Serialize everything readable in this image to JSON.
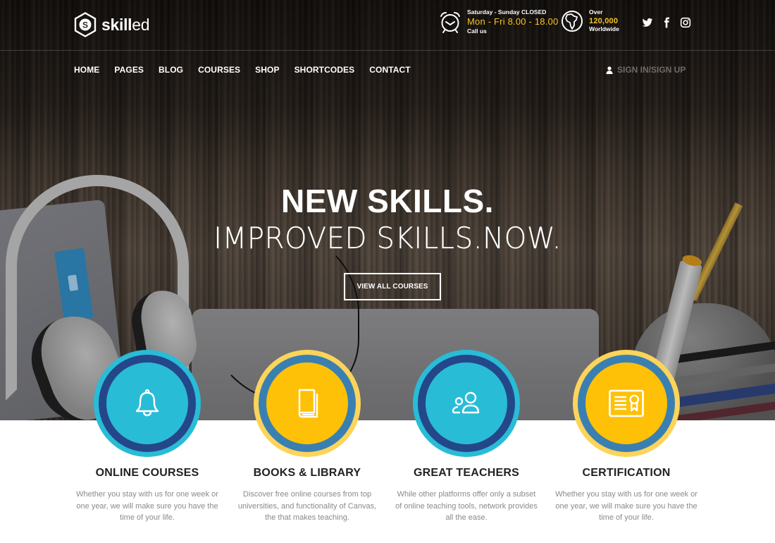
{
  "brand": {
    "name_bold": "skill",
    "name_light": "ed",
    "logo_letter": "S"
  },
  "topbar": {
    "hours": {
      "icon": "alarm-clock-icon",
      "line1": "Saturday - Sunday CLOSED",
      "line2": "Mon - Fri 8.00 - 18.00",
      "line3": "Call us"
    },
    "reach": {
      "icon": "globe-africa-icon",
      "line1": "Over",
      "line2": "120,000",
      "line3": "Worldwide"
    },
    "social": [
      {
        "name": "twitter",
        "icon": "twitter-icon"
      },
      {
        "name": "facebook",
        "icon": "facebook-icon"
      },
      {
        "name": "instagram",
        "icon": "instagram-icon"
      }
    ]
  },
  "nav": {
    "items": [
      {
        "label": "HOME"
      },
      {
        "label": "PAGES"
      },
      {
        "label": "BLOG"
      },
      {
        "label": "COURSES"
      },
      {
        "label": "SHOP"
      },
      {
        "label": "SHORTCODES"
      },
      {
        "label": "CONTACT"
      }
    ],
    "signin_label": "SIGN IN/SIGN UP",
    "signin_icon": "user-icon"
  },
  "hero": {
    "title": "NEW SKILLS.",
    "subtitle": "IMPROVED SKILLS.NOW.",
    "cta_label": "VIEW ALL COURSES"
  },
  "colors": {
    "accent_yellow": "#f6c324",
    "cyan": "#29bcd6",
    "navy": "#24478a",
    "gold": "#ffc107",
    "steel_blue": "#3a7fb1",
    "light_gold": "#fdd45a"
  },
  "features": [
    {
      "title": "ONLINE COURSES",
      "desc": "Whether you stay with us for one week or one year, we will make sure you have the time of your life.",
      "icon": "bell-icon",
      "scheme": "cyan"
    },
    {
      "title": "BOOKS & LIBRARY",
      "desc": "Discover free online courses from top universities, and functionality of Canvas, the that makes teaching.",
      "icon": "book-icon",
      "scheme": "gold"
    },
    {
      "title": "GREAT TEACHERS",
      "desc": "While other platforms offer only a subset of online teaching tools, network provides all the ease.",
      "icon": "users-icon",
      "scheme": "cyan"
    },
    {
      "title": "CERTIFICATION",
      "desc": "Whether you stay with us for one week or one year, we will make sure you have the time of your life.",
      "icon": "certificate-icon",
      "scheme": "gold"
    }
  ]
}
